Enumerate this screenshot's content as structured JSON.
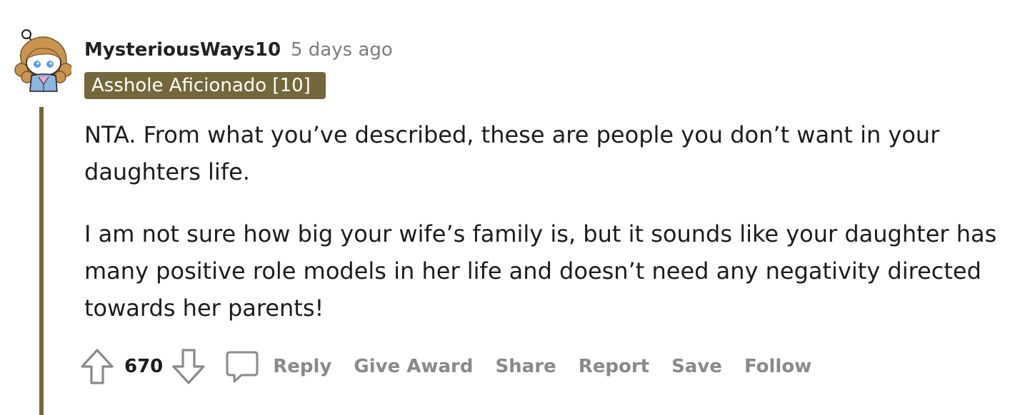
{
  "comment": {
    "author": "MysteriousWays10",
    "separator": "·",
    "timestamp": "5 days ago",
    "flair": "Asshole Aficionado [10]",
    "paragraphs": [
      "NTA. From what you’ve described, these are people you don’t want in your daughters life.",
      "I am not sure how big your wife’s family is, but it sounds like your daughter has many positive role models in her life and doesn’t need any negativity directed towards her parents!"
    ],
    "score": "670",
    "actions": {
      "reply": "Reply",
      "give_award": "Give Award",
      "share": "Share",
      "report": "Report",
      "save": "Save",
      "follow": "Follow"
    }
  },
  "icons": {
    "upvote": "upvote-arrow-icon",
    "downvote": "downvote-arrow-icon",
    "reply": "comment-bubble-icon"
  },
  "colors": {
    "flair_bg": "#74673b",
    "thread_line": "#74673b",
    "meta_gray": "#7c7c7c",
    "action_gray": "#878a8c"
  }
}
